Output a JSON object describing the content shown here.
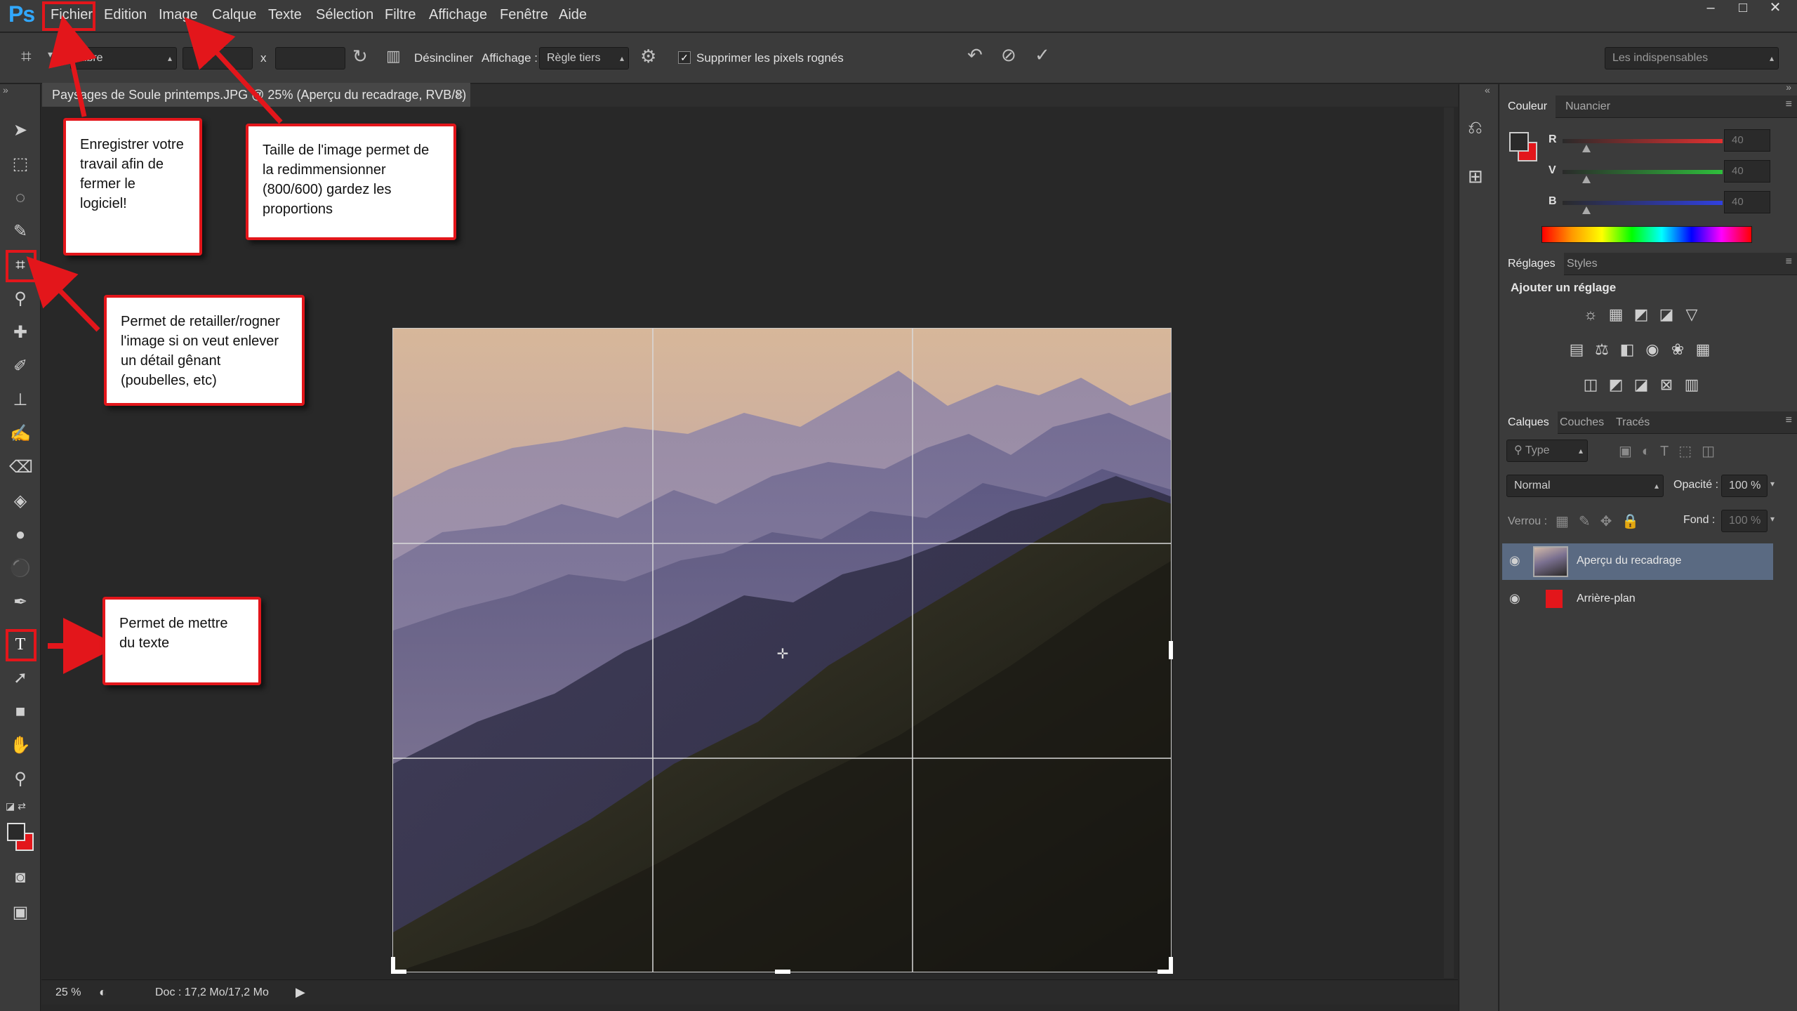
{
  "app": {
    "logo": "Ps",
    "menu": [
      "Fichier",
      "Edition",
      "Image",
      "Calque",
      "Texte",
      "Sélection",
      "Filtre",
      "Affichage",
      "Fenêtre",
      "Aide"
    ],
    "window_controls": [
      "–",
      "□",
      "✕"
    ]
  },
  "options": {
    "ratio_value": "Libre",
    "x_separator": "x",
    "straighten_label": "Désincliner",
    "view_label": "Affichage :",
    "view_value": "Règle tiers",
    "delete_pixels_label": "Supprimer les pixels rognés",
    "delete_pixels_checked": true,
    "workspace_value": "Les indispensables"
  },
  "document": {
    "tab_title": "Paysages de Soule printemps.JPG @ 25% (Aperçu du recadrage, RVB/8) *",
    "tab_close": "×"
  },
  "status": {
    "zoom": "25 %",
    "doc_info": "Doc : 17,2 Mo/17,2 Mo"
  },
  "color_panel": {
    "tabs": [
      "Couleur",
      "Nuancier"
    ],
    "channels": [
      {
        "label": "R",
        "value": "40",
        "color": "#e23030"
      },
      {
        "label": "V",
        "value": "40",
        "color": "#2fbf3c"
      },
      {
        "label": "B",
        "value": "40",
        "color": "#3040e0"
      }
    ]
  },
  "adjust_panel": {
    "tabs": [
      "Réglages",
      "Styles"
    ],
    "heading": "Ajouter un réglage"
  },
  "layers_panel": {
    "tabs": [
      "Calques",
      "Couches",
      "Tracés"
    ],
    "filter_value": "Type",
    "blend_mode": "Normal",
    "opacity_label": "Opacité :",
    "opacity_value": "100 %",
    "lock_label": "Verrou :",
    "fill_label": "Fond :",
    "fill_value": "100 %",
    "layers": [
      {
        "name": "Aperçu du recadrage",
        "selected": true
      },
      {
        "name": "Arrière-plan",
        "selected": false
      }
    ]
  },
  "callouts": {
    "save": "Enregistrer votre travail afin de fermer le logiciel!",
    "image_size": "Taille de l'image permet de la redimmensionner (800/600) gardez les proportions",
    "crop": "Permet de retailler/rogner l'image si on veut enlever un détail gênant (poubelles, etc)",
    "text": "Permet de mettre du texte"
  },
  "colors": {
    "accent_red": "#e3161b",
    "ui_dark": "#282828",
    "ui_panel": "#3b3b3b",
    "ps_blue": "#31a8ff"
  }
}
